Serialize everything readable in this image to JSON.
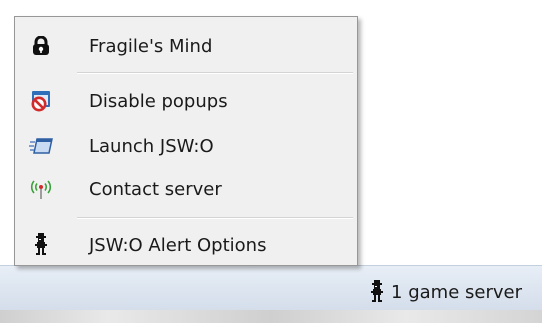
{
  "menu": {
    "items": [
      {
        "label": "Fragile's Mind",
        "icon": "lock-icon"
      },
      {
        "label": "Disable popups",
        "icon": "no-popups-icon"
      },
      {
        "label": "Launch JSW:O",
        "icon": "launch-window-icon"
      },
      {
        "label": "Contact server",
        "icon": "antenna-icon"
      },
      {
        "label": "JSW:O Alert Options",
        "icon": "miner-willy-icon"
      }
    ]
  },
  "taskbar": {
    "status_text": "1 game server",
    "status_icon": "miner-willy-icon"
  },
  "colors": {
    "menu_background": "#f0f0f0",
    "taskbar_background": "#dbe4ef",
    "disable_icon_red": "#d22b2b",
    "disable_icon_blue": "#2f6fb9",
    "antenna_green": "#3aa13a"
  }
}
